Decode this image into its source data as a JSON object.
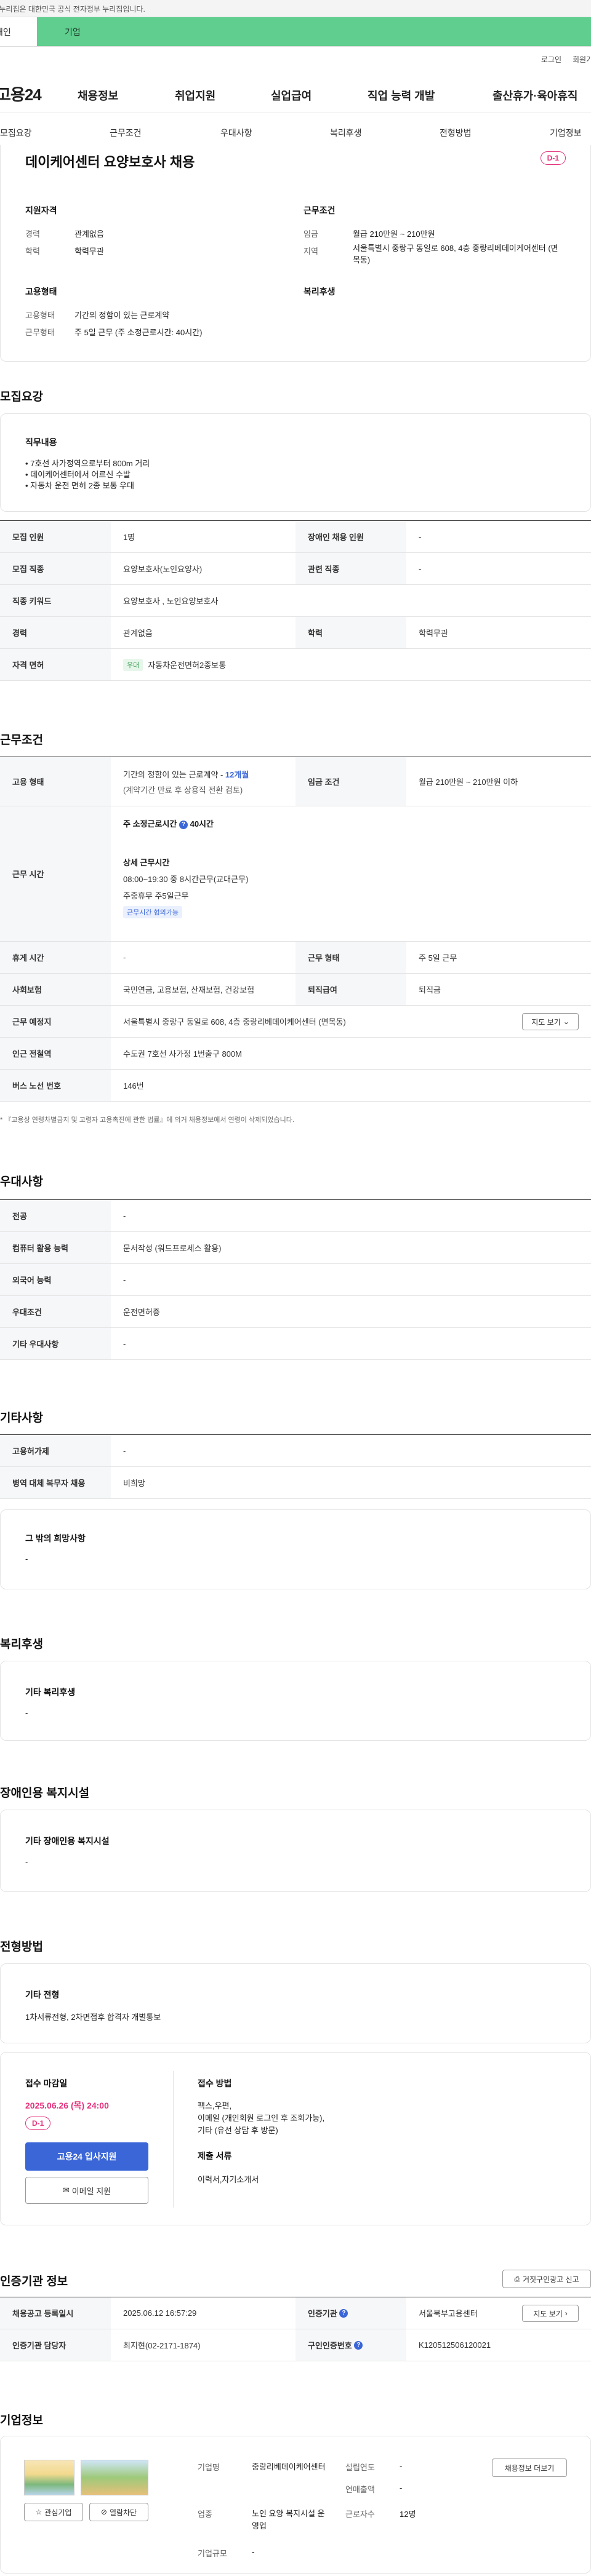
{
  "gov_bar": "이 누리집은 대한민국 공식 전자정부 누리집입니다.",
  "member_tabs": {
    "person": "개인",
    "corp": "기업"
  },
  "util": {
    "login": "로그인",
    "signup": "회원가입"
  },
  "logo": "고용24",
  "gnb": [
    "채용정보",
    "취업지원",
    "실업급여",
    "직업 능력 개발",
    "출산휴가·육아휴직"
  ],
  "subnav": [
    "모집요강",
    "근무조건",
    "우대사항",
    "복리후생",
    "전형방법",
    "기업정보"
  ],
  "header": {
    "title": "데이케어센터 요양보호사 채용",
    "dday": "D-1",
    "qual_title": "지원자격",
    "career_label": "경력",
    "career": "관계없음",
    "edu_label": "학력",
    "edu": "학력무관",
    "cond_title": "근무조건",
    "wage_label": "임금",
    "wage": "월급 210만원 ~ 210만원",
    "region_label": "지역",
    "region": "서울특별시 중랑구 동일로 608, 4층 중랑리베데이케어센터 (면목동)",
    "emp_title": "고용형태",
    "emptype_label": "고용형태",
    "emptype": "기간의 정함이 있는 근로계약",
    "worktype_label": "근무형태",
    "worktype": "주 5일 근무 (주 소정근로시간: 40시간)",
    "welfare_title": "복리후생"
  },
  "recruit": {
    "section": "모집요강",
    "duty_title": "직무내용",
    "duties": [
      "• 7호선 사가정역으로부터 800m 거리",
      "• 데이케어센터에서 어르신 수발",
      "• 자동차 운전 면허 2종 보통 우대"
    ],
    "rows": [
      {
        "l1": "모집 인원",
        "v1": "1명",
        "l2": "장애인 채용 인원",
        "v2": "-"
      },
      {
        "l1": "모집 직종",
        "v1": "요양보호사(노인요양사)",
        "l2": "관련 직종",
        "v2": "-"
      },
      {
        "l1": "직종 키워드",
        "v1": "요양보호사 , 노인요양보호사"
      },
      {
        "l1": "경력",
        "v1": "관계없음",
        "l2": "학력",
        "v2": "학력무관"
      },
      {
        "l1": "자격 면허",
        "v1": "자동차운전면허2종보통",
        "tag": "우대"
      }
    ]
  },
  "conditions": {
    "section": "근무조건",
    "emp_label": "고용 형태",
    "emp_value": "기간의 정함이 있는 근로계약 - ",
    "emp_months": "12개월",
    "emp_sub": "(계약기간 만료 후 상용직 전환 검토)",
    "wage_label": "임금 조건",
    "wage_value": "월급 210만원 ~ 210만원 이하",
    "hours_label": "근무 시간",
    "hours_main": "주 소정근로시간",
    "hours_val": "40시간",
    "hours_detail_title": "상세 근무시간",
    "hours_detail": "08:00~19:30 중 8시간근무(교대근무)",
    "hours_week": "주중휴무 주5일근무",
    "hours_tag": "근무시간 협의가능",
    "rest_label": "휴게 시간",
    "rest": "-",
    "form_label": "근무 형태",
    "form": "주 5일 근무",
    "ins_label": "사회보험",
    "ins": "국민연금, 고용보험, 산재보험, 건강보험",
    "ret_label": "퇴직급여",
    "ret": "퇴직금",
    "place_label": "근무 예정지",
    "place": "서울특별시 중랑구 동일로 608, 4층 중랑리베데이케어센터 (면목동)",
    "map_btn": "지도 보기",
    "subway_label": "인근 전철역",
    "subway": "수도권 7호선 사가정 1번출구 800M",
    "bus_label": "버스 노선 번호",
    "bus": "146번",
    "note": "* 『고용상 연령차별금지 및 고령자 고용촉진에 관한 법률』에 의거 채용정보에서 연령이 삭제되었습니다."
  },
  "preference": {
    "section": "우대사항",
    "rows": [
      {
        "l": "전공",
        "v": "-"
      },
      {
        "l": "컴퓨터 활용 능력",
        "v": "문서작성 (워드프로세스 활용)"
      },
      {
        "l": "외국어 능력",
        "v": "-"
      },
      {
        "l": "우대조건",
        "v": "운전면허증"
      },
      {
        "l": "기타 우대사항",
        "v": "-"
      }
    ]
  },
  "etc": {
    "section": "기타사항",
    "rows": [
      {
        "l": "고용허가제",
        "v": "-"
      },
      {
        "l": "병역 대체 복무자 채용",
        "v": "비희망"
      }
    ],
    "wish_title": "그 밖의 희망사항",
    "wish": "-"
  },
  "welfare": {
    "section": "복리후생",
    "title": "기타 복리후생",
    "value": "-"
  },
  "disability": {
    "section": "장애인용 복지시설",
    "title": "기타 장애인용 복지시설",
    "value": "-"
  },
  "selection": {
    "section": "전형방법",
    "title": "기타 전형",
    "value": "1차서류전형, 2차면접후 합격자 개별통보",
    "deadline_label": "접수 마감일",
    "deadline": "2025.06.26 (목) 24:00",
    "dday": "D-1",
    "apply_btn": "고용24 입사지원",
    "email_btn": "이메일 지원",
    "method_label": "접수 방법",
    "method": "팩스,우편,",
    "method2": "이메일 (개인회원 로그인 후 조회가능),",
    "method3": "기타 (유선 상담 후 방문)",
    "docs_label": "제출 서류",
    "docs": "이력서,자기소개서"
  },
  "cert": {
    "section": "인증기관 정보",
    "report_btn": "거짓구인광고 신고",
    "reg_label": "채용공고 등록일시",
    "reg": "2025.06.12 16:57:29",
    "agency_label": "인증기관",
    "agency": "서울북부고용센터",
    "map_btn": "지도 보기",
    "manager_label": "인증기관 담당자",
    "manager": "최지현(02-2171-1874)",
    "cert_no_label": "구인인증번호",
    "cert_no": "K120512506120021"
  },
  "company": {
    "section": "기업정보",
    "fav_btn": "관심기업",
    "block_btn": "열람차단",
    "name_label": "기업명",
    "name": "중랑리베데이케어센터",
    "found_label": "설립연도",
    "found": "-",
    "revenue_label": "연매출액",
    "revenue": "-",
    "industry_label": "업종",
    "industry": "노인 요양 복지시설 운영업",
    "staff_label": "근로자수",
    "staff": "12명",
    "scale_label": "기업규모",
    "scale": "-",
    "jobs_btn": "채용정보 더보기"
  }
}
